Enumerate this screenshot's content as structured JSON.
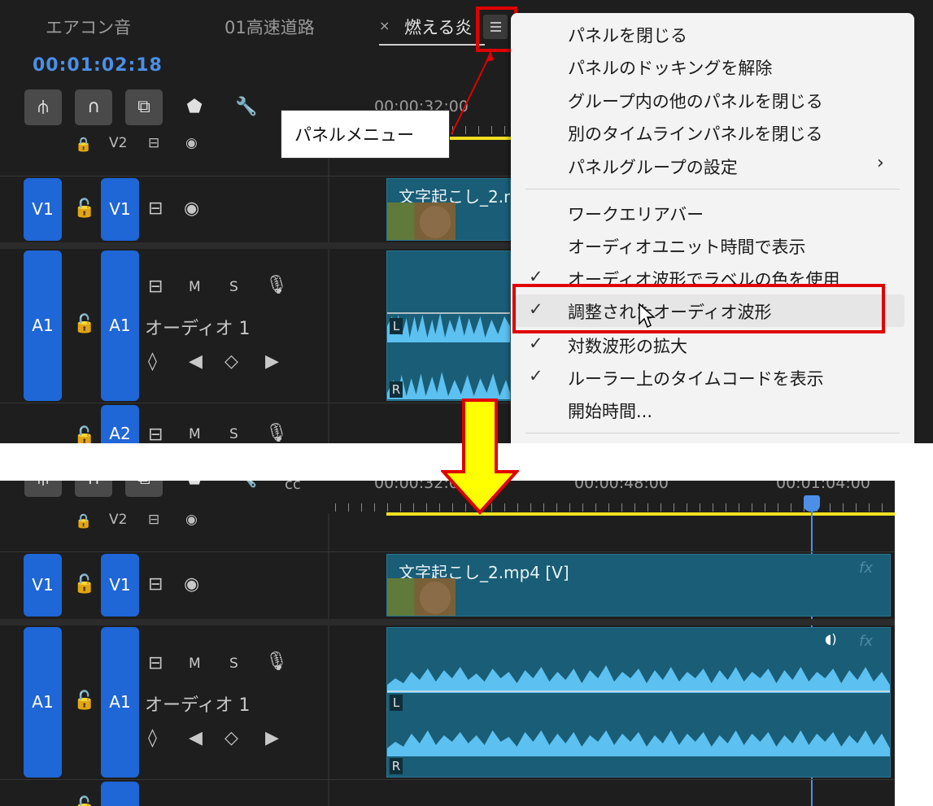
{
  "colors": {
    "accent_blue": "#1f66d6",
    "timecode_blue": "#4a8fe8",
    "highlight_red": "#e00000",
    "clip_teal": "#1a5d76",
    "waveform": "#5cc0f0",
    "work_area_yellow": "#f0e020",
    "arrow_yellow": "#ffff00"
  },
  "tabs": [
    {
      "label": "エアコン音"
    },
    {
      "label": "01高速道路"
    },
    {
      "label": "燃える炎",
      "close": "×",
      "active": true
    }
  ],
  "panel_menu_icon": "hamburger-icon",
  "timecode": "00:01:02:18",
  "toolbar_icons": [
    "insert-icon",
    "magnet-icon",
    "linked-selection-icon",
    "marker-icon",
    "wrench-icon",
    "captions-icon"
  ],
  "toolbar_cc_label": "cc",
  "ruler_top": {
    "time_0": "00:00:32:00"
  },
  "ruler_bottom": {
    "time_0": "00:00:32:00",
    "time_1": "00:00:48:00",
    "time_2": "00:01:04:00"
  },
  "callout": {
    "text": "パネルメニュー"
  },
  "menu": {
    "items": [
      {
        "label": "パネルを閉じる",
        "checked": false
      },
      {
        "label": "パネルのドッキングを解除",
        "checked": false
      },
      {
        "label": "グループ内の他のパネルを閉じる",
        "checked": false
      },
      {
        "label": "別のタイムラインパネルを閉じる",
        "checked": false
      },
      {
        "label": "パネルグループの設定",
        "checked": false,
        "submenu_arrow": "›"
      },
      {
        "label": "ワークエリアバー",
        "checked": false
      },
      {
        "label": "オーディオユニット時間で表示",
        "checked": false
      },
      {
        "label": "オーディオ波形でラベルの色を使用",
        "checked": true
      },
      {
        "label": "調整されたオーディオ波形",
        "checked": true,
        "hovered": true
      },
      {
        "label": "対数波形の拡大",
        "checked": true
      },
      {
        "label": "ルーラー上のタイムコードを表示",
        "checked": true
      },
      {
        "label": "開始時間...",
        "checked": false
      }
    ],
    "check_glyph": "✓"
  },
  "tracks": {
    "v2": {
      "label": "V2"
    },
    "v1": {
      "source": "V1",
      "target": "V1"
    },
    "a1": {
      "source": "A1",
      "target": "A1",
      "name": "オーディオ 1",
      "mute": "M",
      "solo": "S"
    },
    "a2": {
      "target": "A2",
      "mute": "M",
      "solo": "S"
    }
  },
  "clips": {
    "video_top": "文字起こし_2.m",
    "video_bottom": "文字起こし_2.mp4 [V]",
    "fx": "fx",
    "channel_left": "L",
    "channel_right": "R"
  }
}
